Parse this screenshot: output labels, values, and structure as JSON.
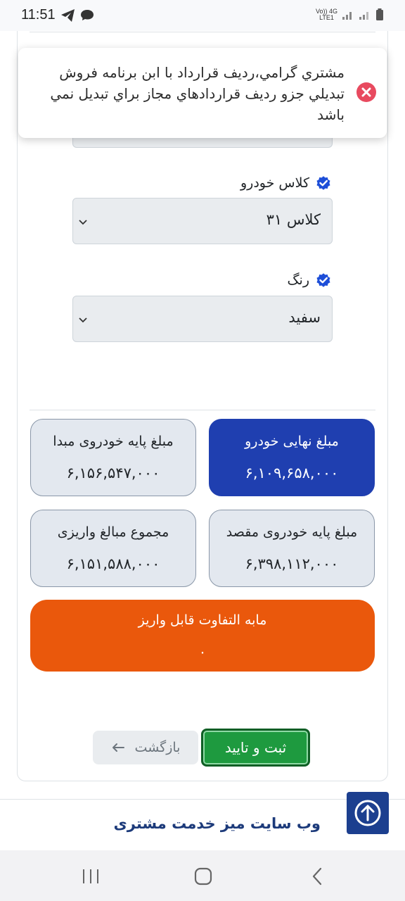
{
  "status_bar": {
    "time": "11:51",
    "network_top": "Vo)) 4G",
    "network_bottom": "LTE1"
  },
  "toast": {
    "message": "مشتري گرامي،رديف قرارداد با ابن برنامه فروش تبديلي جزو رديف قراردادهاي مجاز براي تبديل نمي باشد",
    "icon": "error-x-icon",
    "icon_color": "#e84a5f"
  },
  "form": {
    "car_class": {
      "label": "کلاس خودرو",
      "value": "کلاس ۳۱"
    },
    "color": {
      "label": "رنگ",
      "value": "سفید"
    }
  },
  "amounts": {
    "final_price": {
      "label": "مبلغ نهایی خودرو",
      "value": "۶,۱۰۹,۶۵۸,۰۰۰"
    },
    "base_origin": {
      "label": "مبلغ پایه خودروی مبدا",
      "value": "۶,۱۵۶,۵۴۷,۰۰۰"
    },
    "base_destination": {
      "label": "مبلغ پایه خودروی مقصد",
      "value": "۶,۳۹۸,۱۱۲,۰۰۰"
    },
    "total_paid": {
      "label": "مجموع مبالغ واریزی",
      "value": "۶,۱۵۱,۵۸۸,۰۰۰"
    },
    "difference": {
      "label": "مابه التفاوت قابل واریز",
      "value": "۰"
    }
  },
  "actions": {
    "submit_label": "ثبت و تایید",
    "back_label": "بازگشت"
  },
  "footer": {
    "title": "وب سایت میز خدمت مشتری"
  },
  "colors": {
    "primary_blue": "#1f3fb0",
    "orange": "#ea580c",
    "green": "#1e9a3f",
    "check_blue": "#1d4ed8"
  }
}
